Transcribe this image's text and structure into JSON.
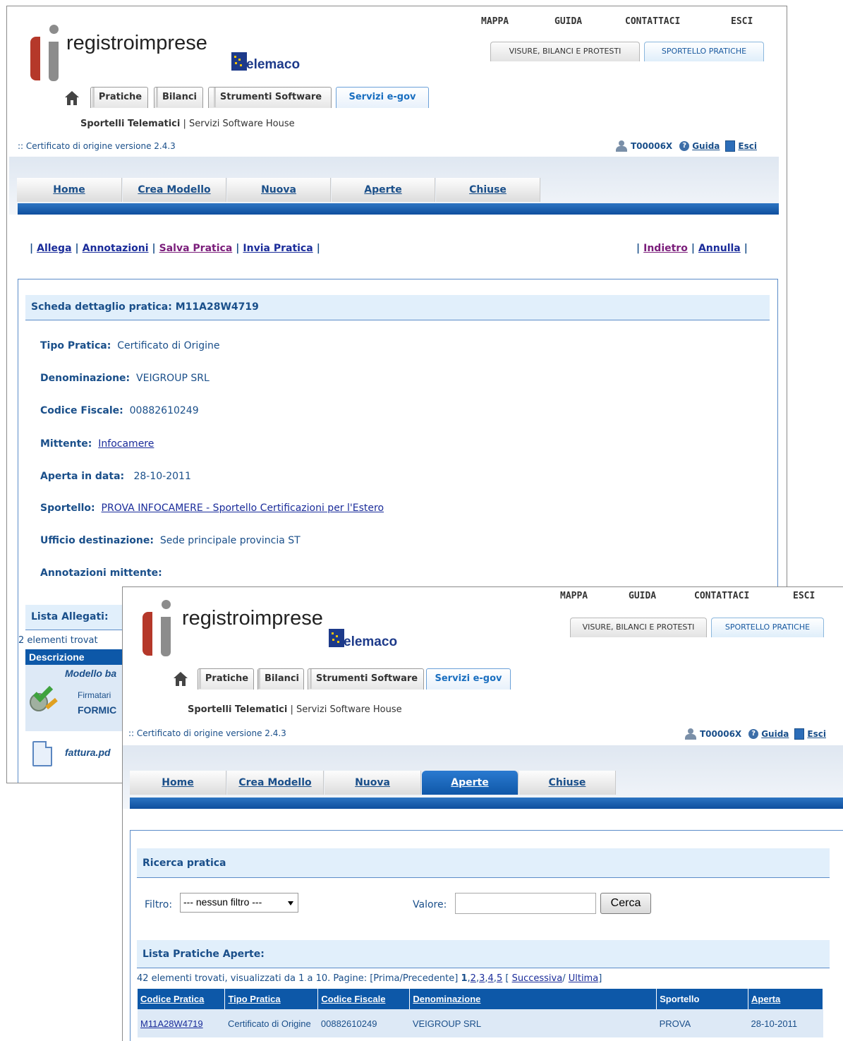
{
  "header": {
    "top_links": [
      "MAPPA",
      "GUIDA",
      "CONTATTACI",
      "ESCI"
    ],
    "logo_text": "registroimprese",
    "telemaco_text": "elemaco",
    "right_tabs": [
      "VISURE, BILANCI E PROTESTI",
      "SPORTELLO PRATICHE"
    ],
    "nav_tabs": [
      "Pratiche",
      "Bilanci",
      "Strumenti Software",
      "Servizi e-gov"
    ],
    "subnav_bold": "Sportelli Telematici",
    "subnav_sep": " | ",
    "subnav_rest": "Servizi Software House",
    "cert_version": ":: Certificato di origine versione 2.4.3",
    "user_code": "T00006X",
    "guida": "Guida",
    "esci": "Esci",
    "main_tabs": [
      "Home",
      "Crea Modello",
      "Nuova",
      "Aperte",
      "Chiuse"
    ]
  },
  "detail": {
    "actions_left": [
      "Allega",
      "Annotazioni",
      "Salva Pratica",
      "Invia Pratica"
    ],
    "actions_right": [
      "Indietro",
      "Annulla"
    ],
    "title": "Scheda dettaglio pratica: M11A28W4719",
    "fields": [
      {
        "label": "Tipo Pratica:",
        "value": "Certificato di Origine"
      },
      {
        "label": "Denominazione:",
        "value": "VEIGROUP SRL"
      },
      {
        "label": "Codice Fiscale:",
        "value": "00882610249"
      },
      {
        "label": "Mittente:",
        "value": "Infocamere"
      },
      {
        "label": "Aperta in data:",
        "value": "28-10-2011"
      },
      {
        "label": "Sportello:",
        "value": "PROVA INFOCAMERE - Sportello Certificazioni per l'Estero"
      },
      {
        "label": "Ufficio destinazione:",
        "value": "Sede principale provincia ST"
      },
      {
        "label": "Annotazioni mittente:",
        "value": ""
      }
    ],
    "allegati_title": "Lista Allegati:",
    "allegati_count": "2 elementi trovat",
    "allegati_header": "Descrizione",
    "allegato1_title": "Modello ba",
    "allegato1_firmatario": "Firmatari",
    "allegato1_name": "FORMIC",
    "allegato2_title": "fattura.pd"
  },
  "search": {
    "title": "Ricerca pratica",
    "filtro_label": "Filtro:",
    "filtro_value": "--- nessun filtro ---",
    "valore_label": "Valore:",
    "valore_value": "",
    "cerca": "Cerca",
    "list_title": "Lista Pratiche Aperte:",
    "count_text": "42 elementi trovati, visualizzati da 1 a 10. Pagine: [Prima/Precedente]",
    "current_page": "1",
    "pages": [
      "2",
      "3",
      "4",
      "5"
    ],
    "open_bracket": "[",
    "next": "Successiva",
    "slash": "/",
    "last": "Ultima",
    "close_bracket": "]",
    "columns": [
      "Codice Pratica",
      "Tipo Pratica",
      "Codice Fiscale",
      "Denominazione",
      "Sportello",
      "Aperta"
    ],
    "rows": [
      [
        "M11A28W4719",
        "Certificato di Origine",
        "00882610249",
        "VEIGROUP SRL",
        "PROVA",
        "28-10-2011"
      ]
    ]
  }
}
